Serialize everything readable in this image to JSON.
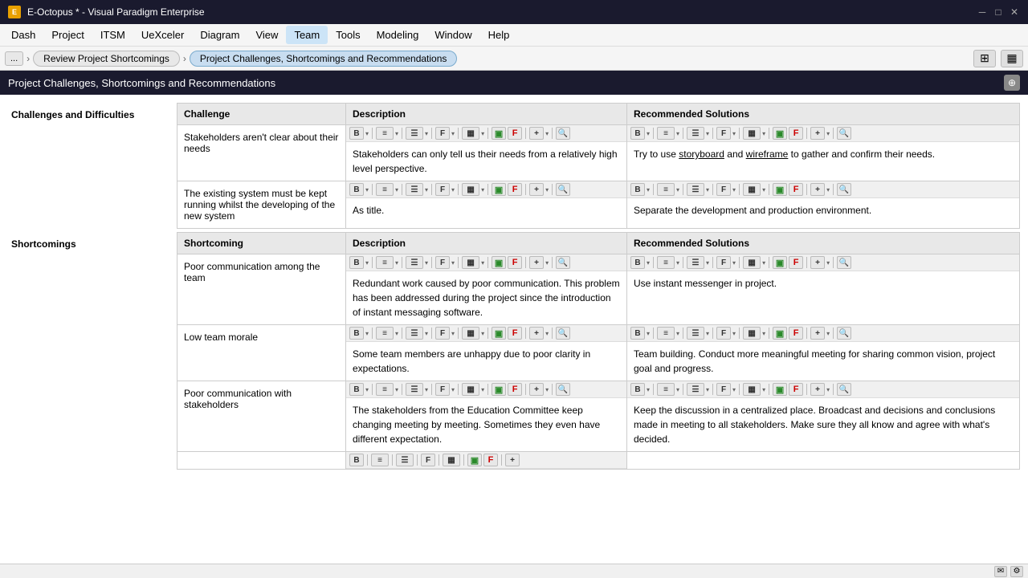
{
  "titlebar": {
    "appname": "E-Octopus * - Visual Paradigm Enterprise"
  },
  "menubar": {
    "items": [
      "Dash",
      "Project",
      "ITSM",
      "UeXceler",
      "Diagram",
      "View",
      "Team",
      "Tools",
      "Modeling",
      "Window",
      "Help"
    ]
  },
  "breadcrumb": {
    "back_label": "...",
    "items": [
      "Review Project Shortcomings",
      "Project Challenges, Shortcomings and Recommendations"
    ]
  },
  "page_header": {
    "title": "Project Challenges, Shortcomings and Recommendations"
  },
  "sections": [
    {
      "label": "Challenges and Difficulties",
      "columns": [
        "Challenge",
        "Description",
        "Recommended Solutions"
      ],
      "rows": [
        {
          "challenge": "Stakeholders aren't clear about their needs",
          "description": "Stakeholders can only tell us their needs from a relatively high level perspective.",
          "description_has_toolbar": true,
          "recommended": "Try to use storyboard and wireframe to gather and confirm their needs.",
          "recommended_has_toolbar": true,
          "recommended_underlines": [
            "storyboard",
            "wireframe"
          ]
        },
        {
          "challenge": "The existing system must be kept running whilst the developing of the new system",
          "description": "As title.",
          "description_has_toolbar": true,
          "recommended": "Separate the development and production environment.",
          "recommended_has_toolbar": true
        }
      ]
    },
    {
      "label": "Shortcomings",
      "columns": [
        "Shortcoming",
        "Description",
        "Recommended Solutions"
      ],
      "rows": [
        {
          "challenge": "Poor communication among the team",
          "description": "Redundant work caused by poor communication. This problem has been addressed during the project since the introduction of instant messaging software.",
          "description_has_toolbar": true,
          "recommended": "Use instant messenger in project.",
          "recommended_has_toolbar": true
        },
        {
          "challenge": "Low team morale",
          "description": "Some team members are unhappy due to poor clarity in expectations.",
          "description_has_toolbar": true,
          "recommended": "Team building. Conduct more meaningful meeting for sharing common vision, project goal and progress.",
          "recommended_has_toolbar": true
        },
        {
          "challenge": "Poor communication with stakeholders",
          "description": "The stakeholders from the Education Committee keep changing meeting by meeting. Sometimes they even have different expectation.",
          "description_has_toolbar": true,
          "recommended": "Keep the discussion in a centralized place. Broadcast and decisions and conclusions made in meeting to all stakeholders. Make sure they all know and agree with what's decided.",
          "recommended_has_toolbar": true
        }
      ]
    }
  ]
}
